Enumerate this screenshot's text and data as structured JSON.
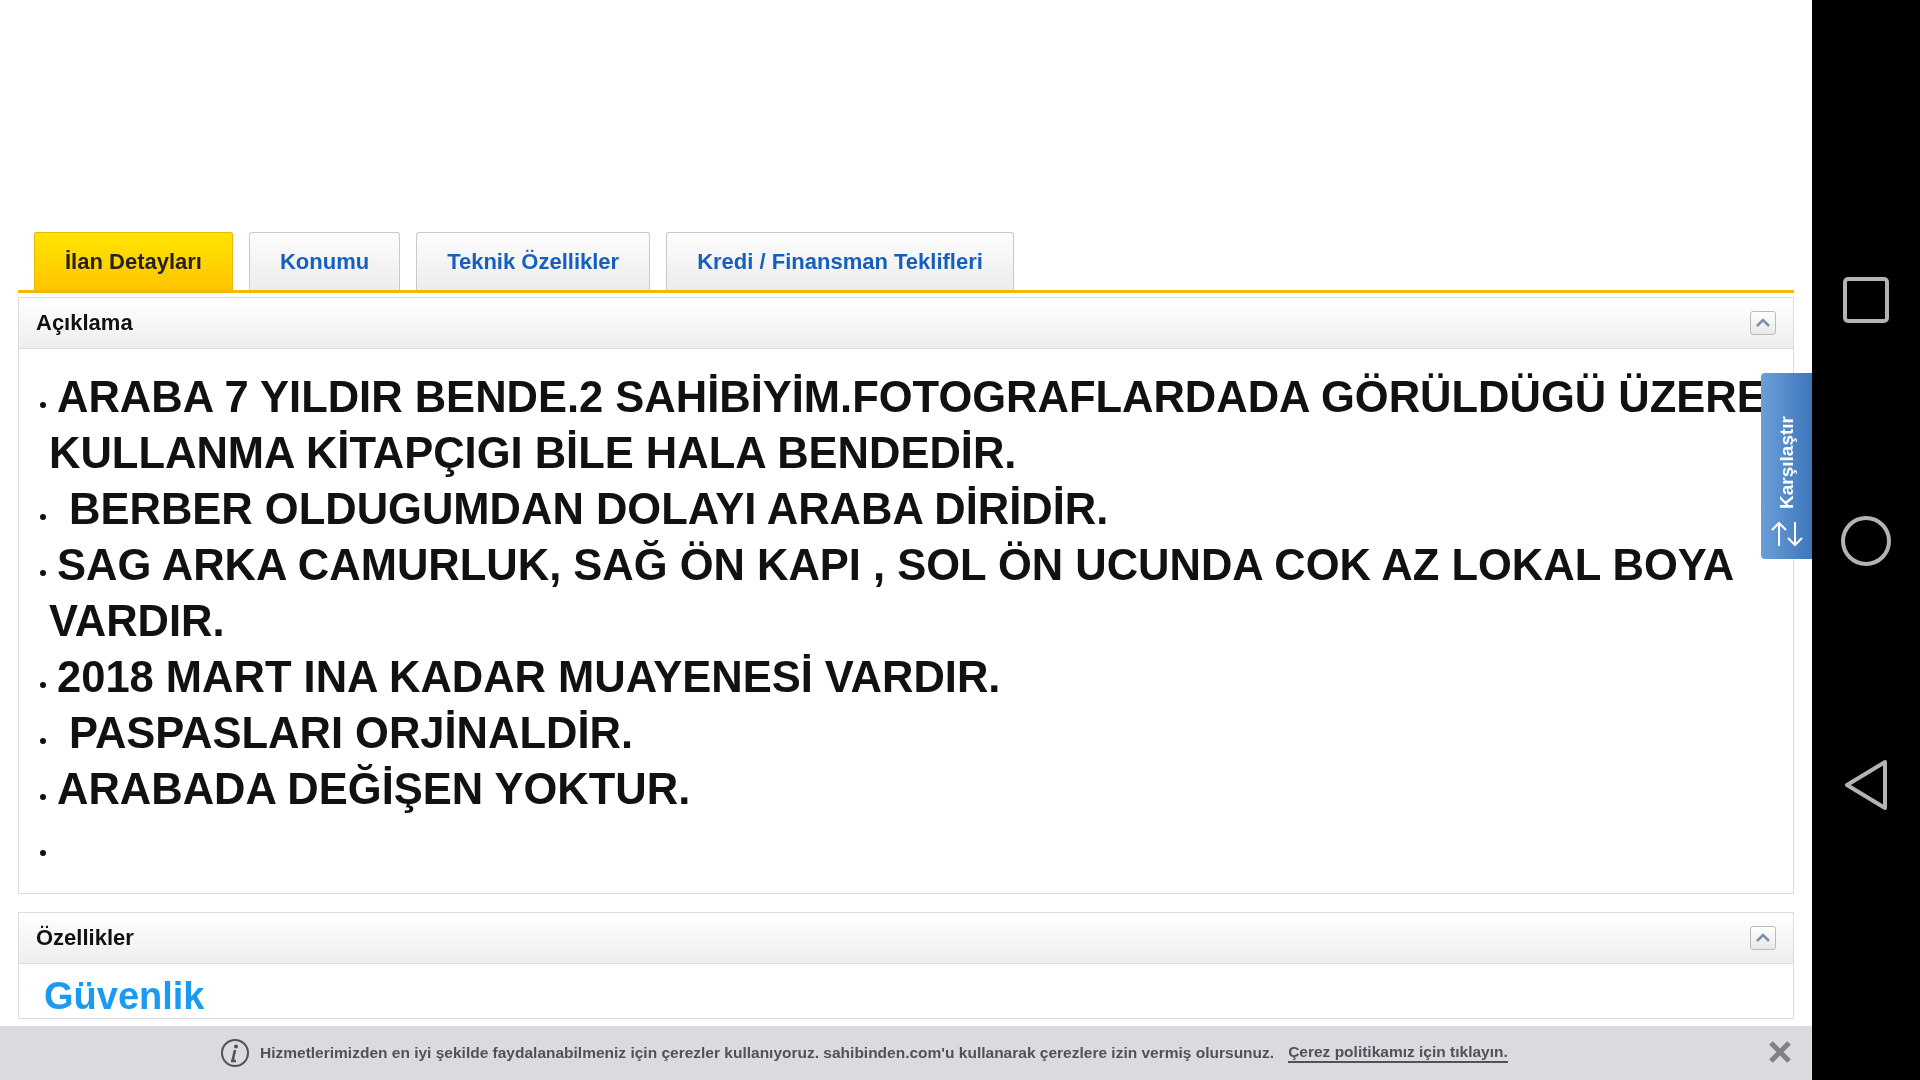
{
  "tabs": [
    {
      "label": "İlan Detayları",
      "selected": true
    },
    {
      "label": "Konumu",
      "selected": false
    },
    {
      "label": "Teknik Özellikler",
      "selected": false
    },
    {
      "label": "Kredi / Finansman Teklifleri",
      "selected": false
    }
  ],
  "description": {
    "title": "Açıklama",
    "expanded": true,
    "items": [
      {
        "text": "ARABA 7 YILDIR BENDE.2 SAHİBİYİM.FOTOGRAFLARDADA GÖRÜLDÜGÜ ÜZERE KULLANMA KİTAPÇIGI BİLE HALA BENDEDİR."
      },
      {
        "text": " BERBER OLDUGUMDAN DOLAYI ARABA DİRİDİR."
      },
      {
        "text": "SAG ARKA CAMURLUK, SAĞ ÖN KAPI , SOL ÖN UCUNDA COK AZ LOKAL BOYA VARDIR."
      },
      {
        "text": "2018 MART INA KADAR MUAYENESİ VARDIR."
      },
      {
        "text": " PASPASLARI ORJİNALDİR."
      },
      {
        "text": "ARABADA DEĞİŞEN YOKTUR."
      }
    ],
    "trailing_bullet": true
  },
  "features": {
    "title": "Özellikler",
    "expanded": true,
    "heading": "Güvenlik"
  },
  "compare_tab": {
    "label": "Karşılaştır"
  },
  "cookie_bar": {
    "message": "Hizmetlerimizden en iyi şekilde faydalanabilmeniz için çerezler kullanıyoruz. sahibinden.com'u kullanarak çerezlere izin vermiş olursunuz.",
    "link": "Çerez politikamız için tıklayın."
  }
}
